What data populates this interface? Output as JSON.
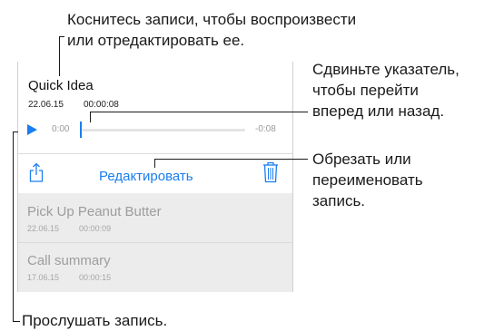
{
  "callouts": {
    "top_line1": "Коснитесь записи, чтобы воспроизвести",
    "top_line2": "или отредактировать ее.",
    "right1_line1": "Сдвиньте указатель,",
    "right1_line2": "чтобы перейти",
    "right1_line3": "вперед или назад.",
    "right2_line1": "Обрезать или",
    "right2_line2": "переименовать",
    "right2_line3": "запись.",
    "bottom": "Прослушать запись."
  },
  "recording": {
    "title": "Quick Idea",
    "date": "22.06.15",
    "duration": "00:00:08",
    "time_elapsed": "0:00",
    "time_remaining": "-0:08",
    "progress": 0
  },
  "toolbar": {
    "share_icon": "share-icon",
    "edit_label": "Редактировать",
    "trash_icon": "trash-icon"
  },
  "list": [
    {
      "title": "Pick Up Peanut Butter",
      "date": "22.06.15",
      "duration": "00:00:09"
    },
    {
      "title": "Call summary",
      "date": "17.06.15",
      "duration": "00:00:15"
    }
  ],
  "colors": {
    "accent": "#1a7ef0",
    "row_bg": "#ececec"
  }
}
